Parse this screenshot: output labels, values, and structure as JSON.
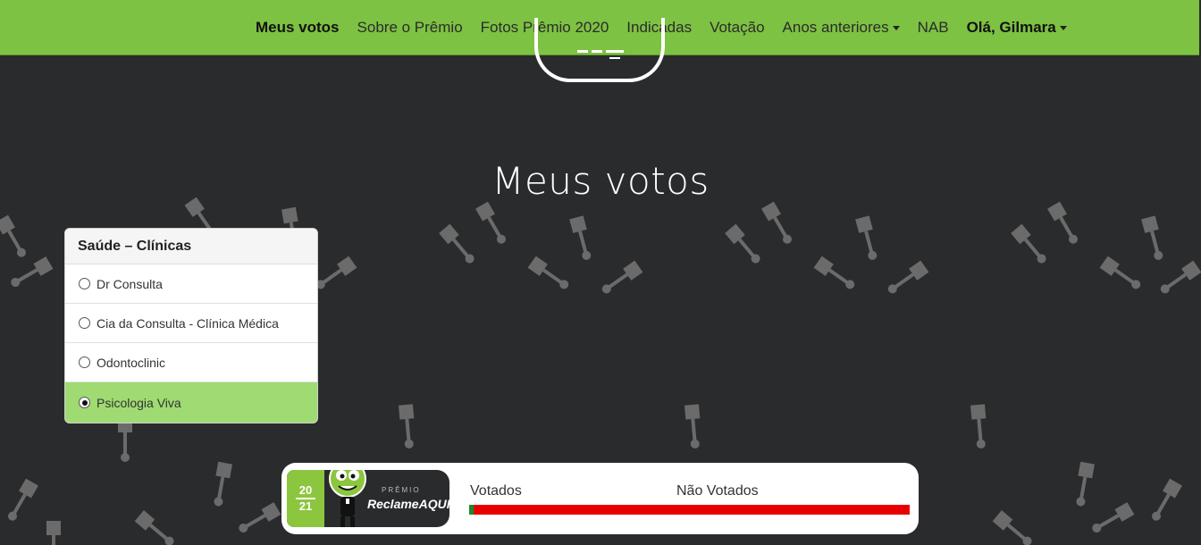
{
  "nav": {
    "items": [
      {
        "label": "Meus votos",
        "active": true,
        "dropdown": false
      },
      {
        "label": "Sobre o Prêmio",
        "active": false,
        "dropdown": false
      },
      {
        "label": "Fotos Prêmio 2020",
        "active": false,
        "dropdown": false
      },
      {
        "label": "Indicadas",
        "active": false,
        "dropdown": false
      },
      {
        "label": "Votação",
        "active": false,
        "dropdown": false
      },
      {
        "label": "Anos anteriores",
        "active": false,
        "dropdown": true
      },
      {
        "label": "NAB",
        "active": false,
        "dropdown": false
      }
    ],
    "user_label": "Olá, Gilmara"
  },
  "page": {
    "title": "Meus votos"
  },
  "category": {
    "title": "Saúde – Clínicas",
    "options": [
      {
        "label": "Dr Consulta",
        "selected": false
      },
      {
        "label": "Cia da Consulta - Clínica Médica",
        "selected": false
      },
      {
        "label": "Odontoclinic",
        "selected": false
      },
      {
        "label": "Psicologia Viva",
        "selected": true
      }
    ]
  },
  "progress": {
    "brand_year_top": "20",
    "brand_year_bottom": "21",
    "brand_premio": "PRÊMIO",
    "brand_name": "ReclameAQUI",
    "voted_label": "Votados",
    "not_voted_label": "Não Votados",
    "voted_fraction": 0.01
  },
  "colors": {
    "nav_bg": "#7dc242",
    "page_bg": "#2a2b2d",
    "selected_option": "#9fdb72",
    "bar_voted": "#1b8a2c",
    "bar_not_voted": "#e80000"
  }
}
